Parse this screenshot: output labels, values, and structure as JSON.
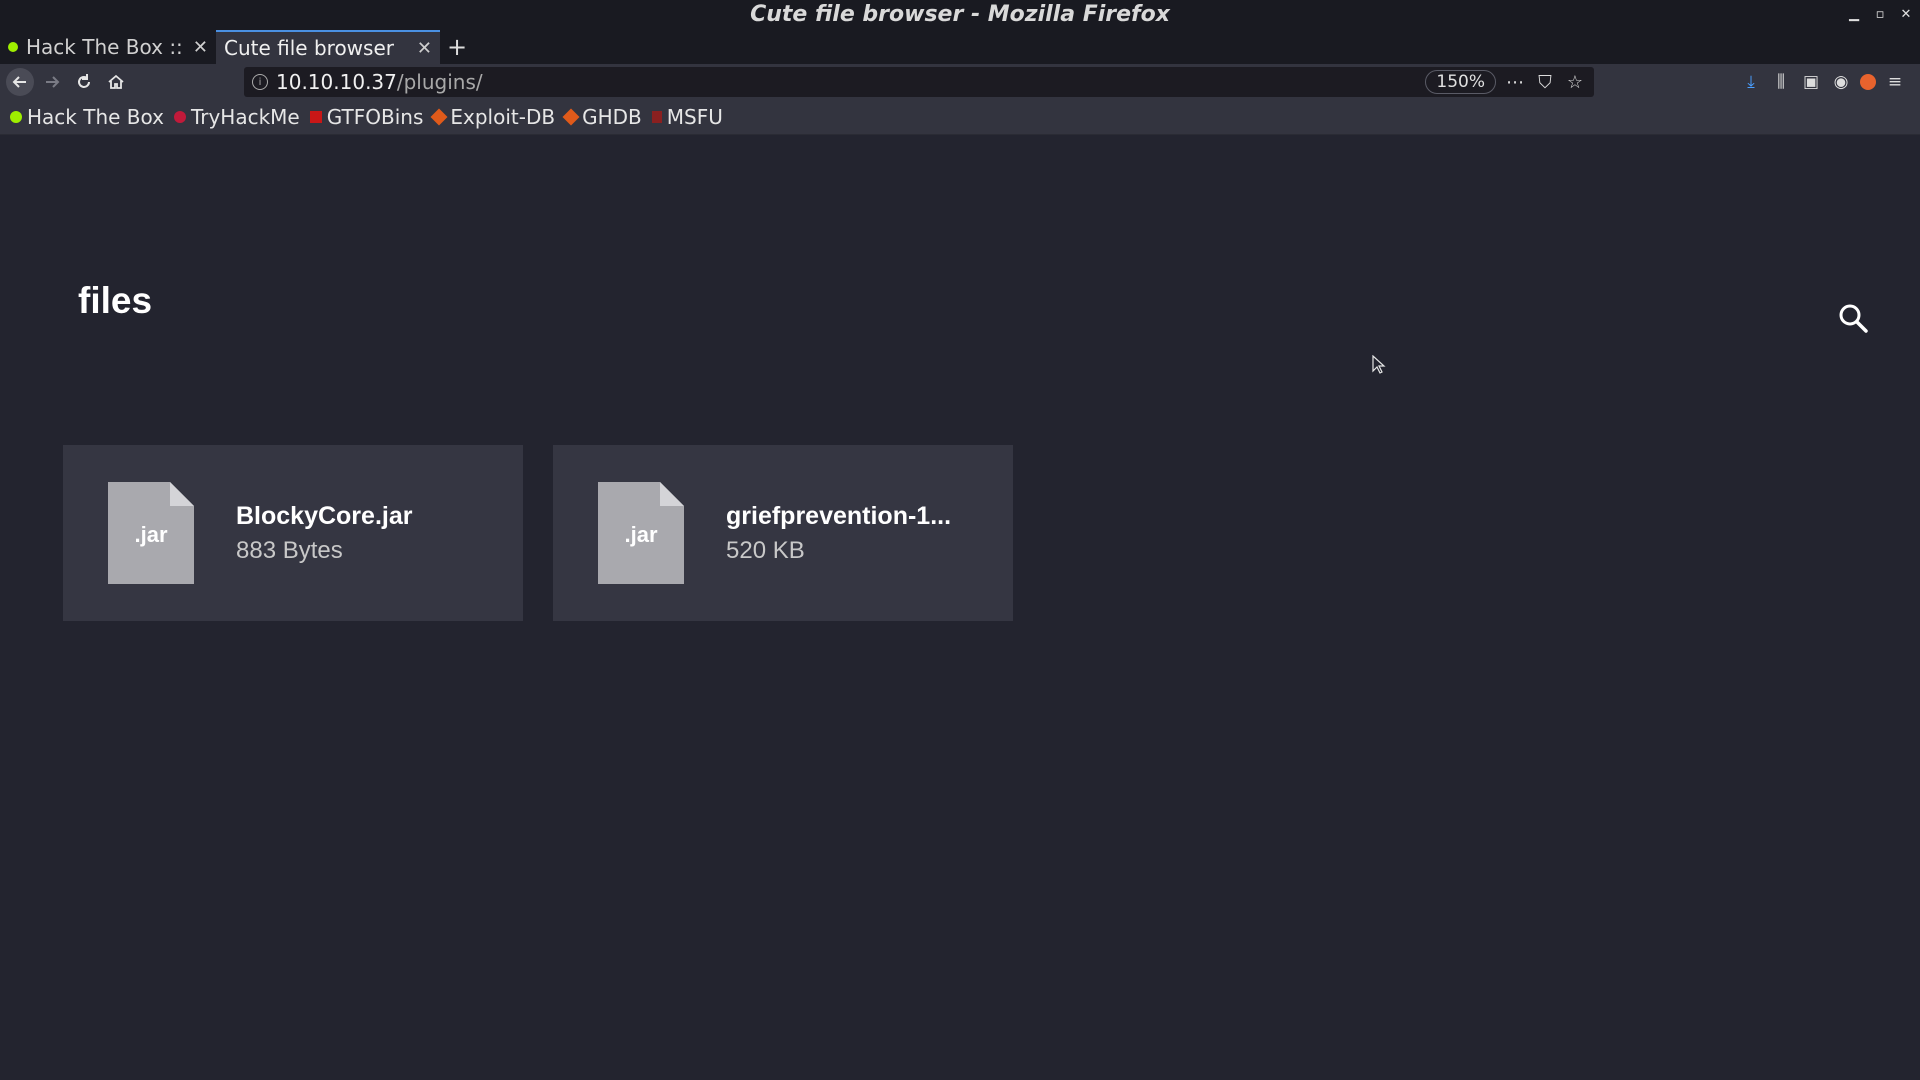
{
  "window": {
    "title": "Cute file browser - Mozilla Firefox"
  },
  "tabs": [
    {
      "label": "Hack The Box :: E",
      "active": false
    },
    {
      "label": "Cute file browser",
      "active": true
    }
  ],
  "navbar": {
    "url_host": "10.10.10.37",
    "url_path": "/plugins/",
    "zoom": "150%"
  },
  "bookmarks": [
    {
      "label": "Hack The Box",
      "icon": "htb-icon"
    },
    {
      "label": "TryHackMe",
      "icon": "tryhackme-icon"
    },
    {
      "label": "GTFOBins",
      "icon": "gtfobins-icon"
    },
    {
      "label": "Exploit-DB",
      "icon": "exploit-db-icon"
    },
    {
      "label": "GHDB",
      "icon": "ghdb-icon"
    },
    {
      "label": "MSFU",
      "icon": "msfu-icon"
    }
  ],
  "page": {
    "title": "files",
    "files": [
      {
        "name": "BlockyCore.jar",
        "size": "883 Bytes",
        "ext": ".jar"
      },
      {
        "name": "griefprevention-1...",
        "size": "520 KB",
        "ext": ".jar"
      }
    ]
  },
  "colors": {
    "background": "#23242f",
    "card": "#353642",
    "file_icon": "#a9a9ae",
    "accent": "#4a90e2"
  }
}
